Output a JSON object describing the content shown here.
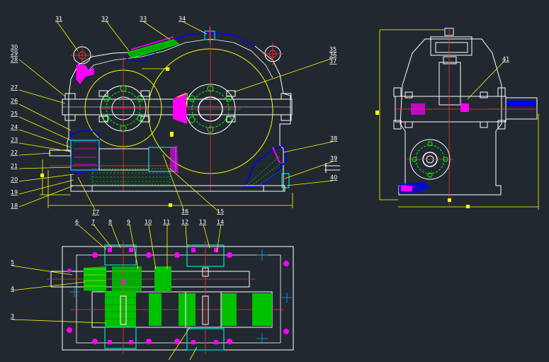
{
  "colors": {
    "background": "#212830",
    "outline": "#ffffff",
    "dimension": "#ffff00",
    "centerline": "#ff3030",
    "leader": "#ffff00",
    "hatch_green": "#00c000",
    "fill_blue": "#0000ff",
    "magenta": "#ff00ff",
    "cyan": "#00ffff",
    "green": "#00ff00"
  },
  "labels": {
    "front": [
      "31",
      "32",
      "33",
      "34",
      "35",
      "36",
      "37",
      "30",
      "29",
      "28",
      "27",
      "26",
      "25",
      "24",
      "23",
      "22",
      "21",
      "20",
      "19",
      "18",
      "17",
      "16",
      "15",
      "38",
      "39",
      "40"
    ],
    "side": [
      "41"
    ],
    "plan": [
      "6",
      "7",
      "8",
      "9",
      "10",
      "11",
      "12",
      "13",
      "14",
      "5",
      "4",
      "3"
    ]
  }
}
